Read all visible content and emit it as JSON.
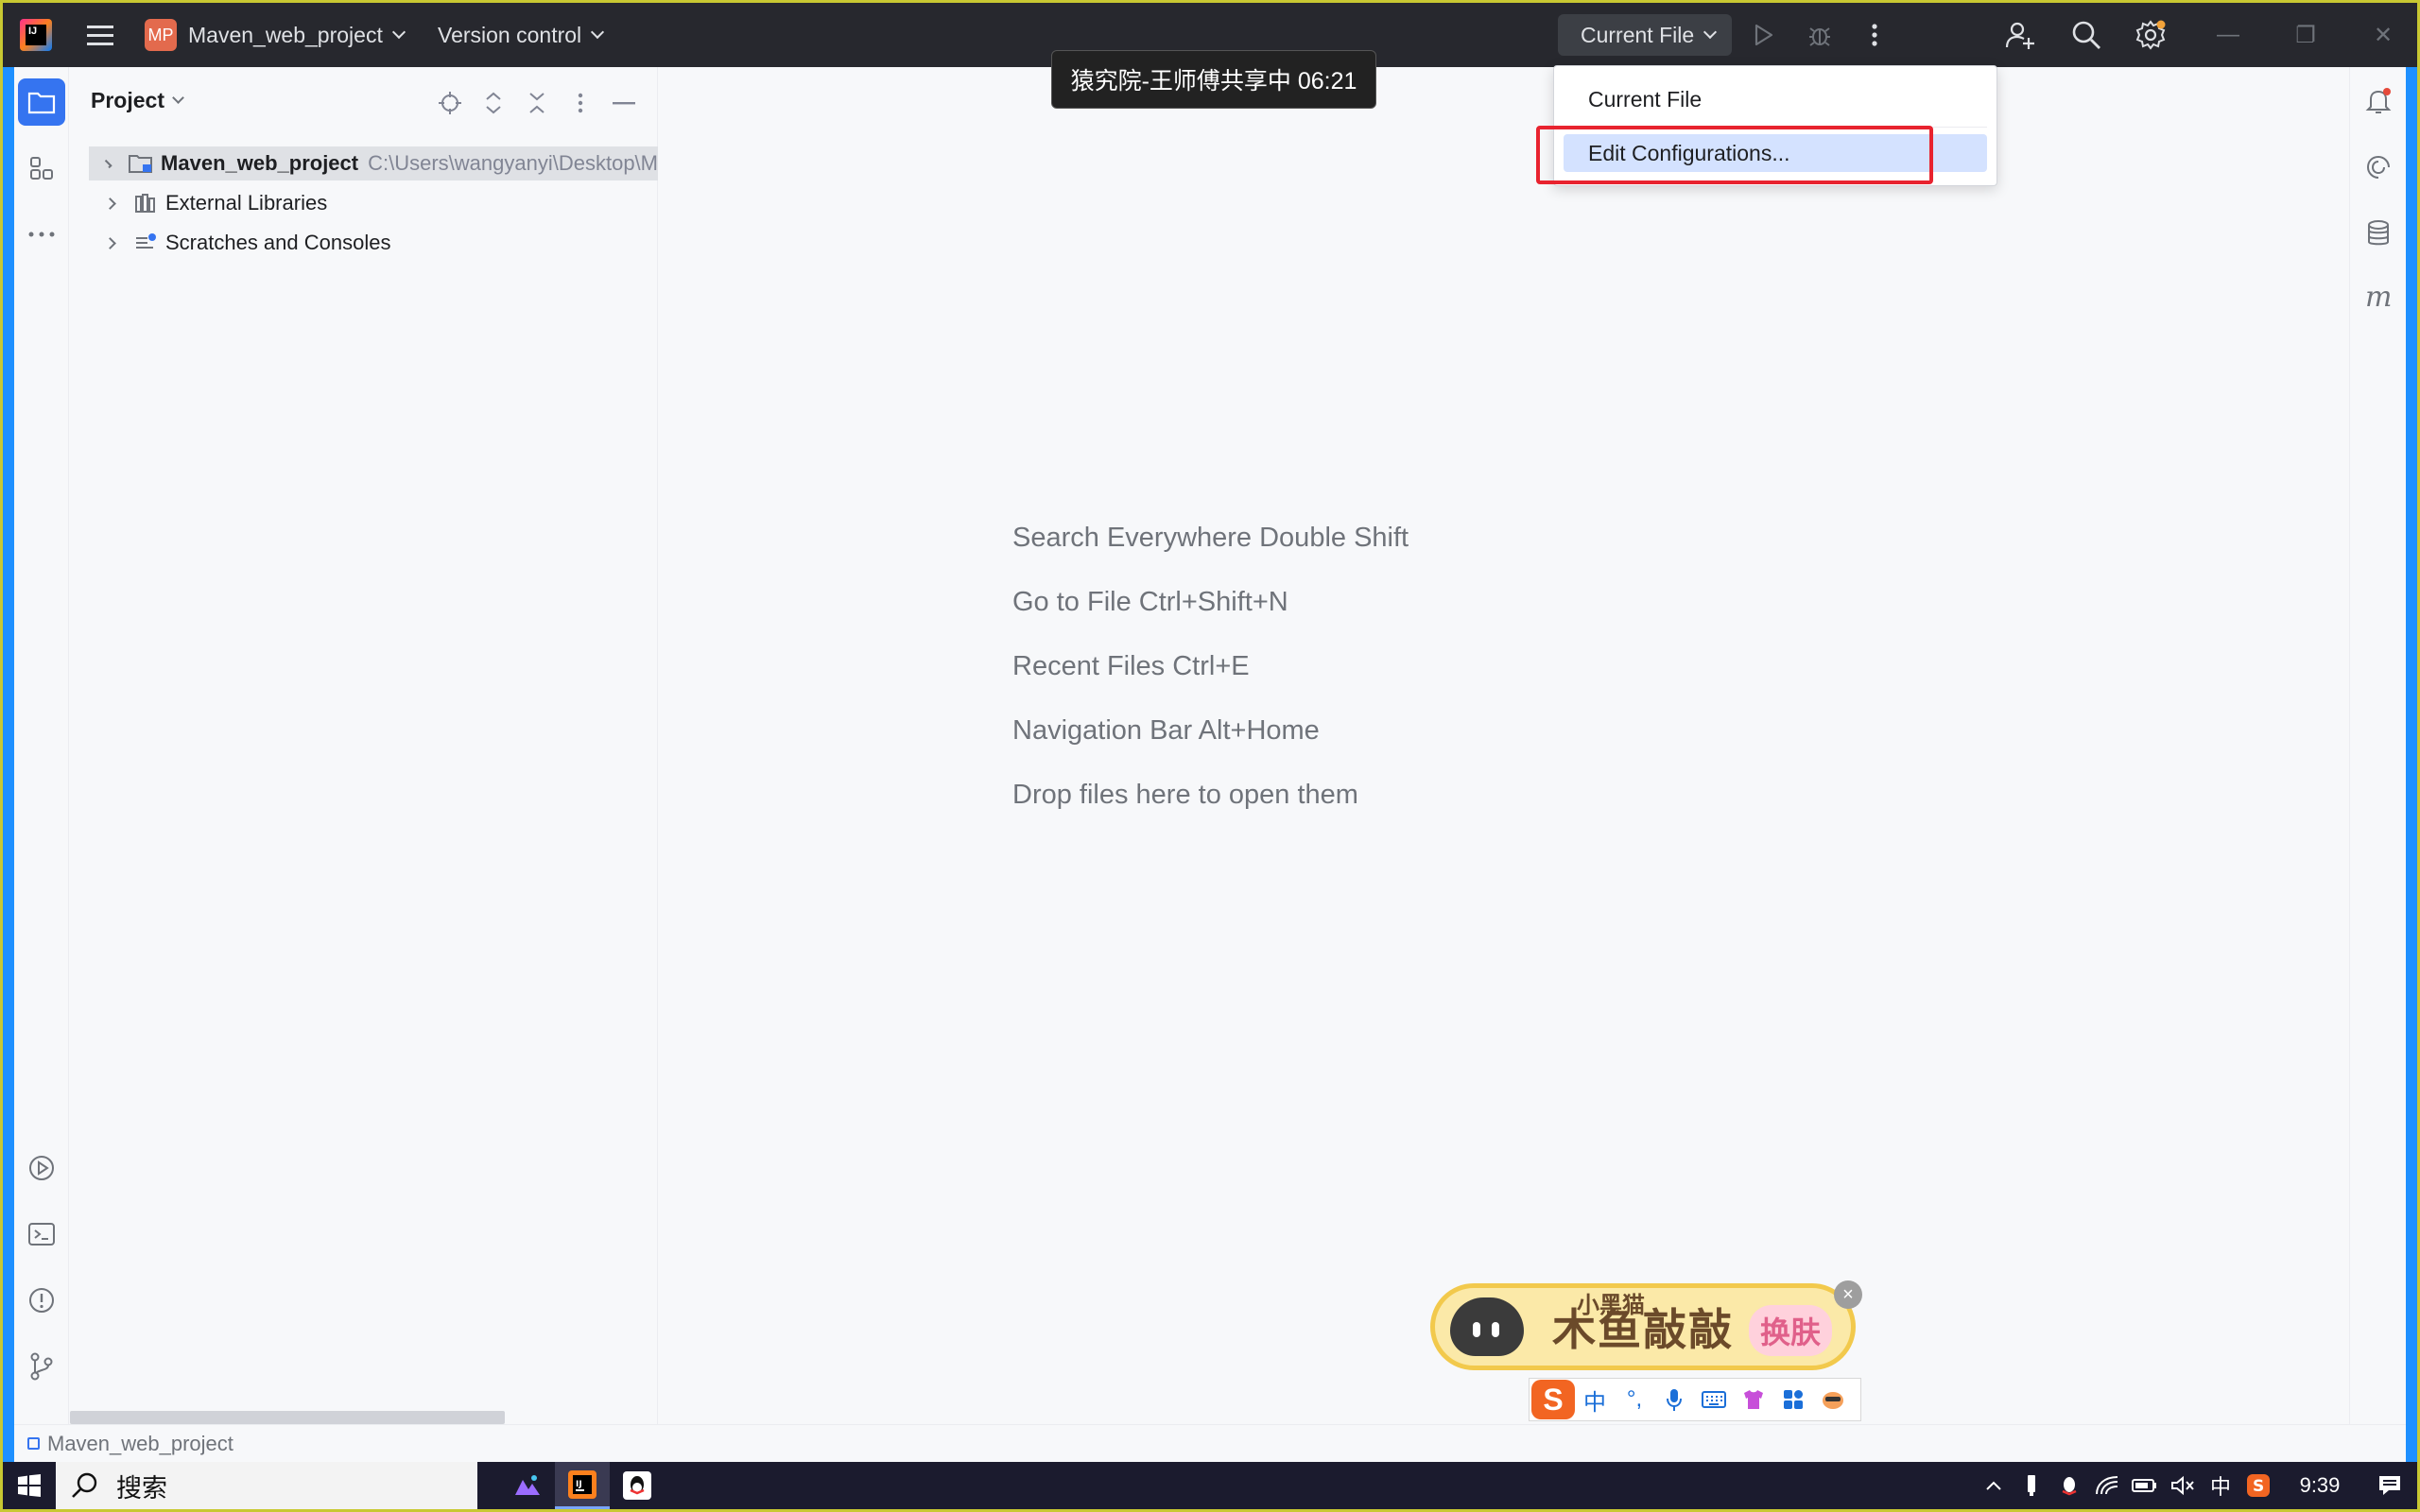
{
  "titlebar": {
    "project_badge": "MP",
    "project_name": "Maven_web_project",
    "vcs_label": "Version control",
    "run_config": "Current File"
  },
  "share_overlay": "猿究院-王师傅共享中 06:21",
  "run_menu": {
    "items": [
      "Current File",
      "Edit Configurations..."
    ],
    "selected_index": 1
  },
  "project_panel": {
    "title": "Project",
    "tree": [
      {
        "label": "Maven_web_project",
        "path": "C:\\Users\\wangyanyi\\Desktop\\M",
        "bold": true,
        "icon": "module-folder-icon"
      },
      {
        "label": "External Libraries",
        "icon": "libraries-icon"
      },
      {
        "label": "Scratches and Consoles",
        "icon": "scratches-icon"
      }
    ]
  },
  "editor": {
    "hints": [
      "Search Everywhere Double Shift",
      "Go to File Ctrl+Shift+N",
      "Recent Files Ctrl+E",
      "Navigation Bar Alt+Home",
      "Drop files here to open them"
    ]
  },
  "statusbar": {
    "breadcrumb": "Maven_web_project"
  },
  "taskbar": {
    "search_placeholder": "搜索",
    "ime_mode": "中",
    "clock": "9:39"
  },
  "sticker": {
    "small_text": "小黑猫",
    "main_text": "木鱼敲敲",
    "button": "换肤"
  },
  "ime_bar": {
    "mode": "中",
    "punct": "°,"
  },
  "colors": {
    "titlebar_bg": "#27282e",
    "accent": "#3574f0",
    "highlight_box": "#e8232f",
    "menu_selected": "#d4e2ff",
    "ide_bg": "#f7f8fa"
  }
}
